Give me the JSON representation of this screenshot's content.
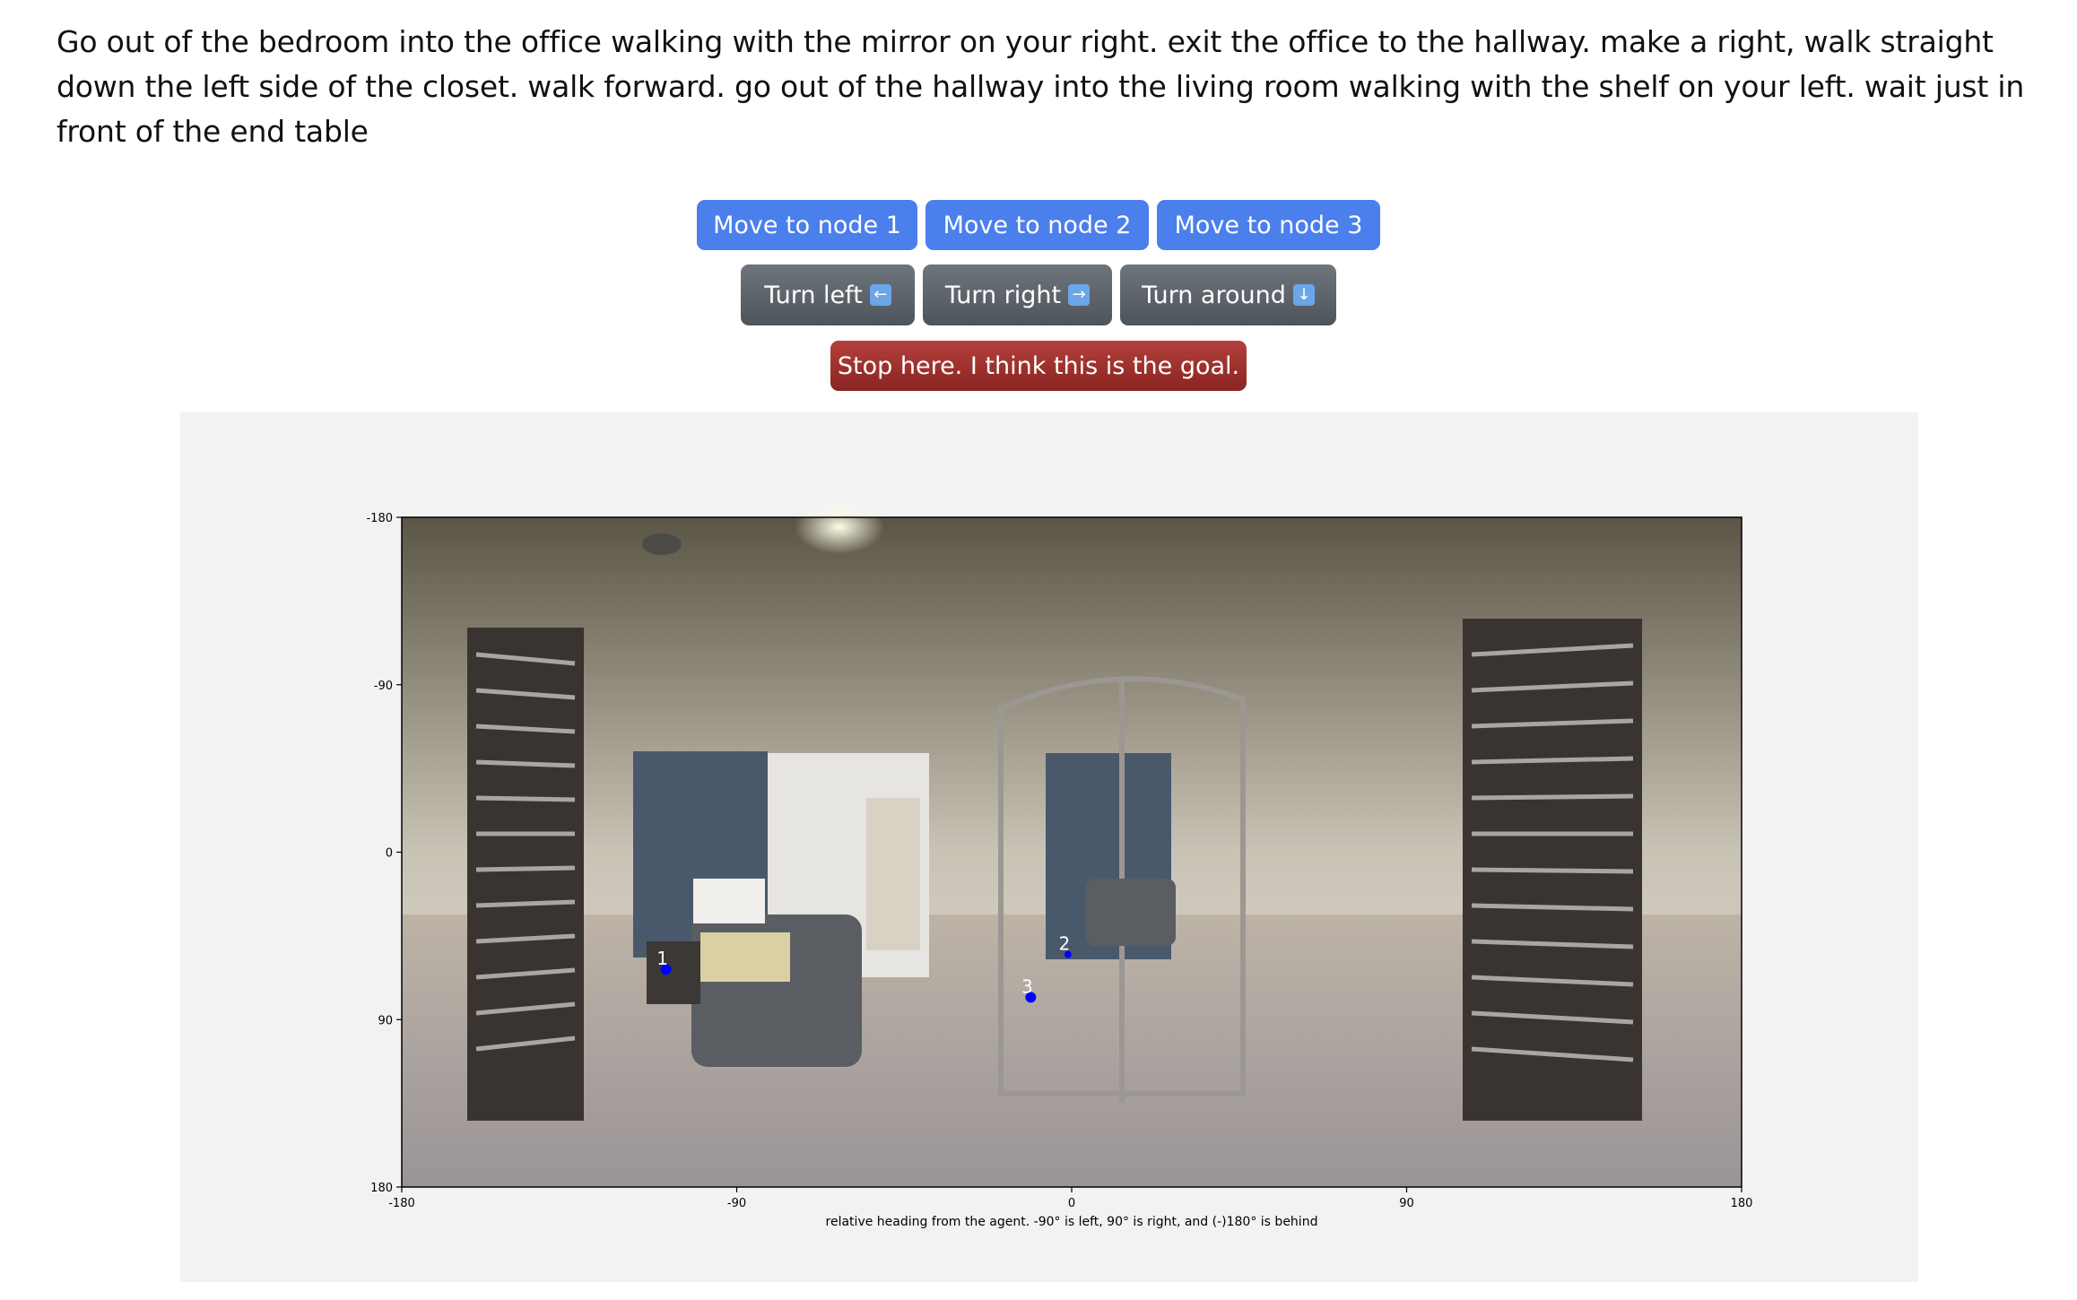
{
  "instruction": "Go out of the bedroom into the office walking with the mirror on your right. exit the office to the hallway. make a right, walk straight down the left side of the closet. walk forward. go out of the hallway into the living room walking with the shelf on your left. wait just in front of the end table",
  "buttons": {
    "move1": "Move to node 1",
    "move2": "Move to node 2",
    "move3": "Move to node 3",
    "turn_left": "Turn left",
    "turn_right": "Turn right",
    "turn_around": "Turn around",
    "stop": "Stop here. I think this is the goal."
  },
  "icons": {
    "turn_left": "left-arrow-emoji-icon",
    "turn_right": "right-arrow-emoji-icon",
    "turn_around": "down-arrow-emoji-icon"
  },
  "colors": {
    "move_button": "#4a7fec",
    "turn_button": "#5e646b",
    "stop_button": "#9e302c",
    "node_marker": "#0000ff"
  },
  "chart_data": {
    "type": "scatter",
    "title": "",
    "xlabel": "relative heading from the agent. -90° is left, 90° is right, and (-)180° is behind",
    "ylabel": "",
    "xlim": [
      -180,
      180
    ],
    "ylim": [
      -180,
      180
    ],
    "y_inverted": true,
    "xticks": [
      "-180",
      "-90",
      "0",
      "90",
      "180"
    ],
    "yticks": [
      "-180",
      "-90",
      "0",
      "90",
      "180"
    ],
    "grid": false,
    "background": "panorama photo of a bedroom",
    "points": [
      {
        "label": "1",
        "x": -109,
        "y": 63
      },
      {
        "label": "2",
        "x": -1,
        "y": 55
      },
      {
        "label": "3",
        "x": -11,
        "y": 78
      }
    ]
  }
}
